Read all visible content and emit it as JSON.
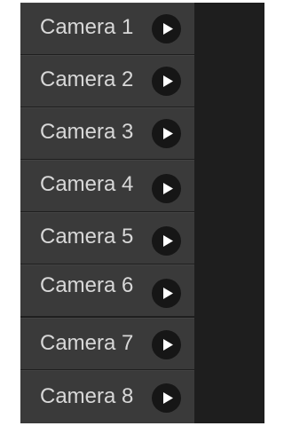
{
  "cameras": [
    {
      "label": "Camera 1",
      "icon": "play-icon"
    },
    {
      "label": "Camera 2",
      "icon": "play-icon"
    },
    {
      "label": "Camera 3",
      "icon": "play-icon"
    },
    {
      "label": "Camera 4",
      "icon": "play-icon"
    },
    {
      "label": "Camera 5",
      "icon": "play-icon"
    },
    {
      "label": "Camera 6",
      "icon": "play-icon"
    },
    {
      "label": "Camera 7",
      "icon": "play-icon"
    },
    {
      "label": "Camera 8",
      "icon": "play-icon"
    }
  ],
  "colors": {
    "row": "#3a3a3a",
    "panel": "#1e1e1e",
    "text": "#d8d8d8",
    "play_bg": "#161616",
    "play_glyph": "#ffffff"
  }
}
